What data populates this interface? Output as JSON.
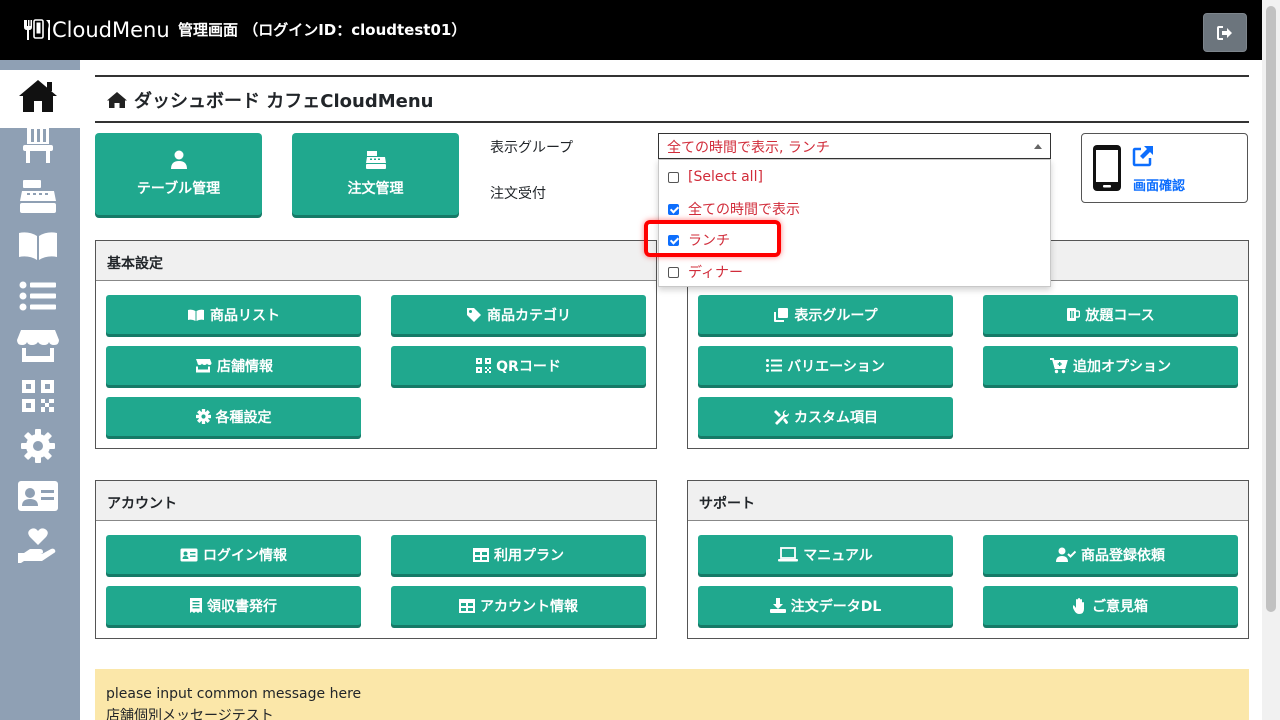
{
  "header": {
    "logo_text": "CloudMenu",
    "title": "管理画面 （ログインID：cloudtest01）"
  },
  "page": {
    "title": "ダッシュボード カフェCloudMenu"
  },
  "top_buttons": {
    "table": "テーブル管理",
    "order": "注文管理"
  },
  "display_group": {
    "label": "表示グループ",
    "order_label": "注文受付",
    "selected_value": "全ての時間で表示, ランチ",
    "options": [
      {
        "label": "[Select all]",
        "checked": false
      },
      {
        "label": "全ての時間で表示",
        "checked": true
      },
      {
        "label": "ランチ",
        "checked": true
      },
      {
        "label": "ディナー",
        "checked": false
      }
    ]
  },
  "screen_check": {
    "label": "画面確認"
  },
  "panels": {
    "basic": {
      "title": "基本設定",
      "buttons": [
        "商品リスト",
        "商品カテゴリ",
        "店舗情報",
        "QRコード",
        "各種設定"
      ]
    },
    "menu": {
      "buttons": [
        "表示グループ",
        "放題コース",
        "バリエーション",
        "追加オプション",
        "カスタム項目"
      ]
    },
    "account": {
      "title": "アカウント",
      "buttons": [
        "ログイン情報",
        "利用プラン",
        "領収書発行",
        "アカウント情報"
      ]
    },
    "support": {
      "title": "サポート",
      "buttons": [
        "マニュアル",
        "商品登録依頼",
        "注文データDL",
        "ご意見箱"
      ]
    }
  },
  "message": {
    "line1": "please input common message here",
    "line2": "店舗個別メッセージテスト"
  },
  "colors": {
    "accent": "#20a88e",
    "sidebar": "#8fa0b4",
    "select_text": "#d12c3a",
    "highlight": "#ff0000",
    "message_bg": "#fbe7a9"
  }
}
